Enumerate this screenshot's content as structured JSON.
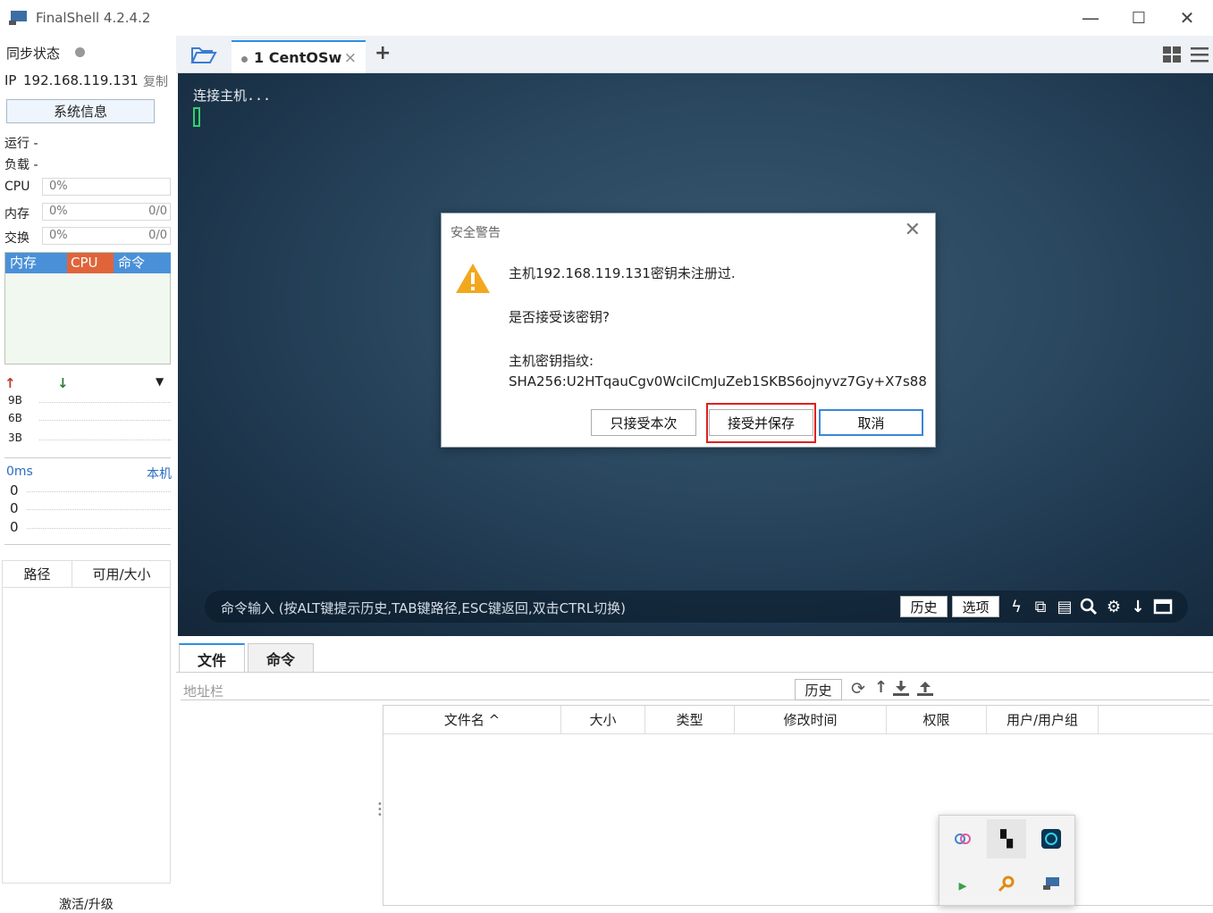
{
  "app": {
    "title": "FinalShell 4.2.4.2",
    "minimize_glyph": "—",
    "maximize_glyph": "☐",
    "close_glyph": "✕"
  },
  "sidebar": {
    "sync_label": "同步状态",
    "ip_label": "IP",
    "ip_value": "192.168.119.131",
    "copy_label": "复制",
    "sysinfo_button": "系统信息",
    "run_label": "运行 -",
    "load_label": "负载 -",
    "cpu_label": "CPU",
    "cpu_value": "0%",
    "mem_label": "内存",
    "mem_value": "0%",
    "mem_ratio": "0/0",
    "swap_label": "交换",
    "swap_value": "0%",
    "swap_ratio": "0/0",
    "proc_tabs": [
      "内存",
      "CPU",
      "命令"
    ],
    "net_ticks": [
      "9B",
      "6B",
      "3B"
    ],
    "latency_label": "0ms",
    "latency_host": "本机",
    "latency_values": [
      "0",
      "0",
      "0"
    ],
    "disk_headers": [
      "路径",
      "可用/大小"
    ],
    "activate_label": "激活/升级"
  },
  "tabs": {
    "session_tab": "1 CentOSw",
    "close_glyph": "×",
    "add_glyph": "+"
  },
  "terminal": {
    "output_line": "连接主机...",
    "command_hint": "命令输入 (按ALT键提示历史,TAB键路径,ESC键返回,双击CTRL切换)",
    "history_button": "历史",
    "options_button": "选项"
  },
  "dialog": {
    "title": "安全警告",
    "close_glyph": "✕",
    "line1": "主机192.168.119.131密钥未注册过.",
    "line2": "是否接受该密钥?",
    "line3": "主机密钥指纹:",
    "line4": "SHA256:U2HTqauCgv0WciICmJuZeb1SKBS6ojnyvz7Gy+X7s88",
    "btn_once": "只接受本次",
    "btn_save": "接受并保存",
    "btn_cancel": "取消"
  },
  "files": {
    "tab_files": "文件",
    "tab_commands": "命令",
    "address_placeholder": "地址栏",
    "history_button": "历史",
    "columns": [
      "文件名 ^",
      "大小",
      "类型",
      "修改时间",
      "权限",
      "用户/用户组"
    ]
  },
  "colors": {
    "accent": "#2d8ee6",
    "mem_tab": "#4a90d9",
    "cpu_tab": "#e0643a",
    "cmd_tab": "#4a90d9",
    "warning": "#f2a81d",
    "highlight": "#e02020"
  }
}
